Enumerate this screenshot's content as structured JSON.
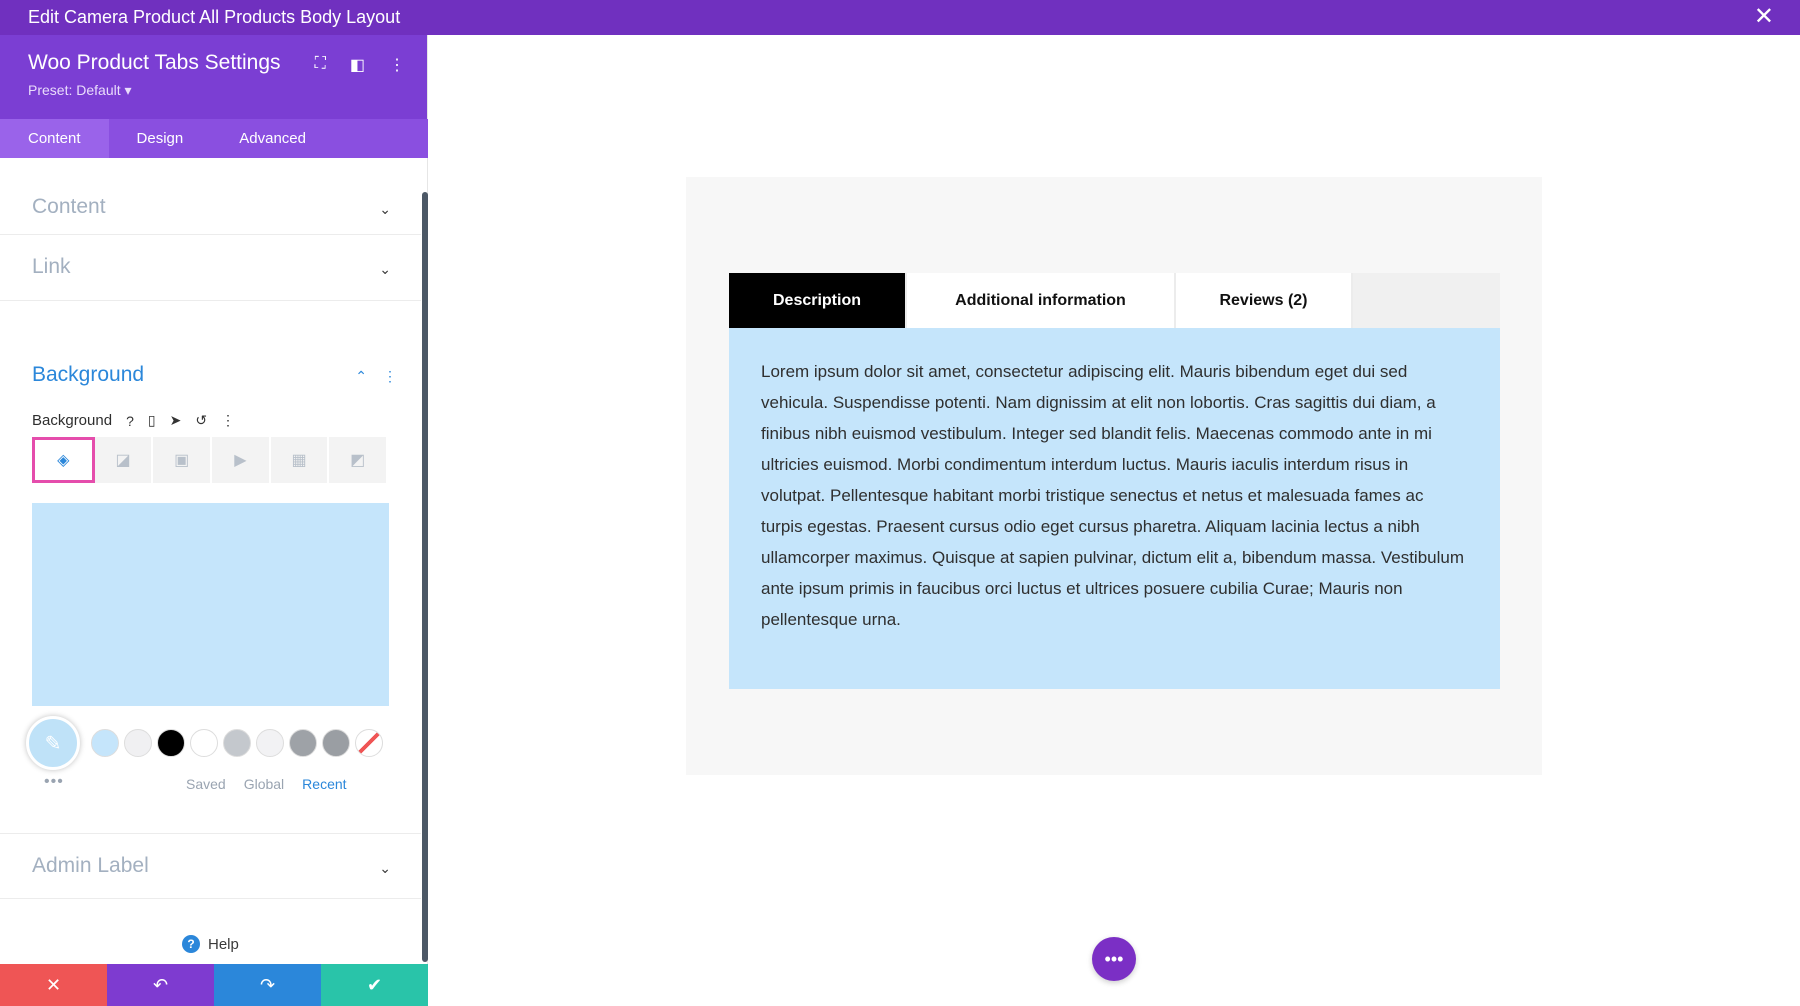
{
  "window": {
    "title": "Edit Camera Product All Products Body Layout",
    "close_glyph": "✕"
  },
  "panel": {
    "title": "Woo Product Tabs Settings",
    "preset": "Preset: Default ▾",
    "header_icons": [
      "fullscreen-icon",
      "split-view-icon",
      "more-icon"
    ],
    "tabs": [
      "Content",
      "Design",
      "Advanced"
    ],
    "active_tab": "Content",
    "sections": {
      "content": "Content",
      "link": "Link",
      "background": "Background",
      "admin_label": "Admin Label"
    },
    "background_field": {
      "label": "Background",
      "type_icons": [
        "paint-bucket-icon",
        "gradient-icon",
        "image-icon",
        "video-icon",
        "pattern-icon",
        "mask-icon"
      ],
      "active_type": "paint-bucket-icon",
      "selected_color": "#c5e5fb",
      "swatches": [
        "#c5e5fb",
        "#f0f0f2",
        "#000000",
        "#ffffff",
        "#c4c8cd",
        "#f2f2f4",
        "#9ea2a7",
        "#9a9ea3",
        "none"
      ],
      "palette_tabs": [
        "Saved",
        "Global",
        "Recent"
      ],
      "active_palette": "Recent"
    },
    "help_label": "Help"
  },
  "bottom_bar": {
    "colors": [
      "#ef5555",
      "#7e3bd0",
      "#2b87da",
      "#29c4a9"
    ]
  },
  "preview": {
    "tabs": [
      "Description",
      "Additional information",
      "Reviews (2)"
    ],
    "active_tab": "Description",
    "description_text": "Lorem ipsum dolor sit amet, consectetur adipiscing elit. Mauris bibendum eget dui sed vehicula. Suspendisse potenti. Nam dignissim at elit non lobortis. Cras sagittis dui diam, a finibus nibh euismod vestibulum. Integer sed blandit felis. Maecenas commodo ante in mi ultricies euismod. Morbi condimentum interdum luctus. Mauris iaculis interdum risus in volutpat. Pellentesque habitant morbi tristique senectus et netus et malesuada fames ac turpis egestas. Praesent cursus odio eget cursus pharetra. Aliquam lacinia lectus a nibh ullamcorper maximus. Quisque at sapien pulvinar, dictum elit a, bibendum massa. Vestibulum ante ipsum primis in faucibus orci luctus et ultrices posuere cubilia Curae; Mauris non pellentesque urna."
  }
}
